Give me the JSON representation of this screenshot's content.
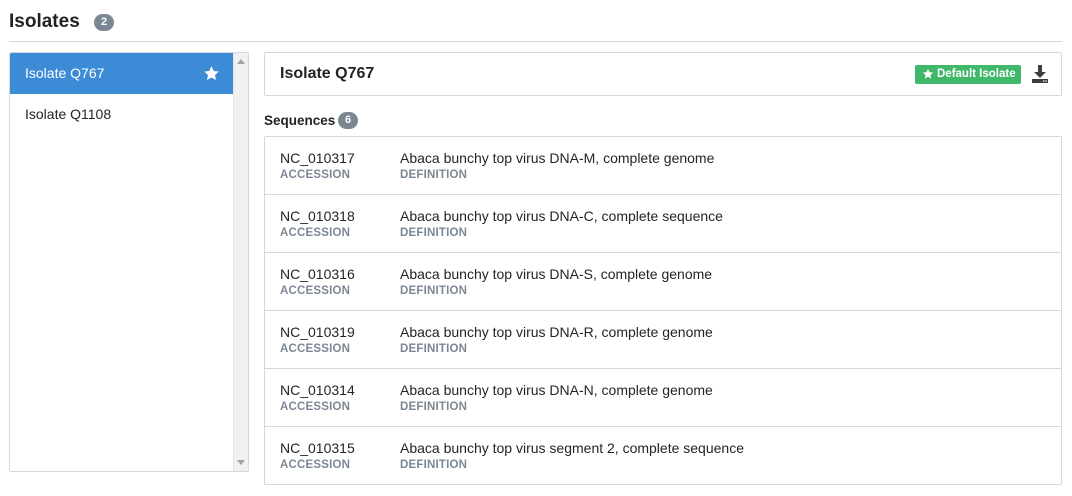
{
  "header": {
    "title": "Isolates",
    "count": "2"
  },
  "isolates": [
    {
      "label": "Isolate Q767",
      "active": true,
      "is_default": true
    },
    {
      "label": "Isolate Q1108",
      "active": false,
      "is_default": false
    }
  ],
  "detail": {
    "title": "Isolate Q767",
    "default_badge": "Default Isolate",
    "badge_icon": "star-icon",
    "download_icon": "download-icon"
  },
  "sequences": {
    "heading": "Sequences",
    "count": "6",
    "accession_label": "ACCESSION",
    "definition_label": "DEFINITION",
    "rows": [
      {
        "accession": "NC_010317",
        "definition": "Abaca bunchy top virus DNA-M, complete genome"
      },
      {
        "accession": "NC_010318",
        "definition": "Abaca bunchy top virus DNA-C, complete sequence"
      },
      {
        "accession": "NC_010316",
        "definition": "Abaca bunchy top virus DNA-S, complete genome"
      },
      {
        "accession": "NC_010319",
        "definition": "Abaca bunchy top virus DNA-R, complete genome"
      },
      {
        "accession": "NC_010314",
        "definition": "Abaca bunchy top virus DNA-N, complete genome"
      },
      {
        "accession": "NC_010315",
        "definition": "Abaca bunchy top virus segment 2, complete sequence"
      }
    ]
  },
  "colors": {
    "active_item": "#3c8bd6",
    "default_badge": "#3fb86a",
    "count_badge": "#7c8794",
    "muted_label": "#7c8794",
    "border": "#d5d9de"
  }
}
